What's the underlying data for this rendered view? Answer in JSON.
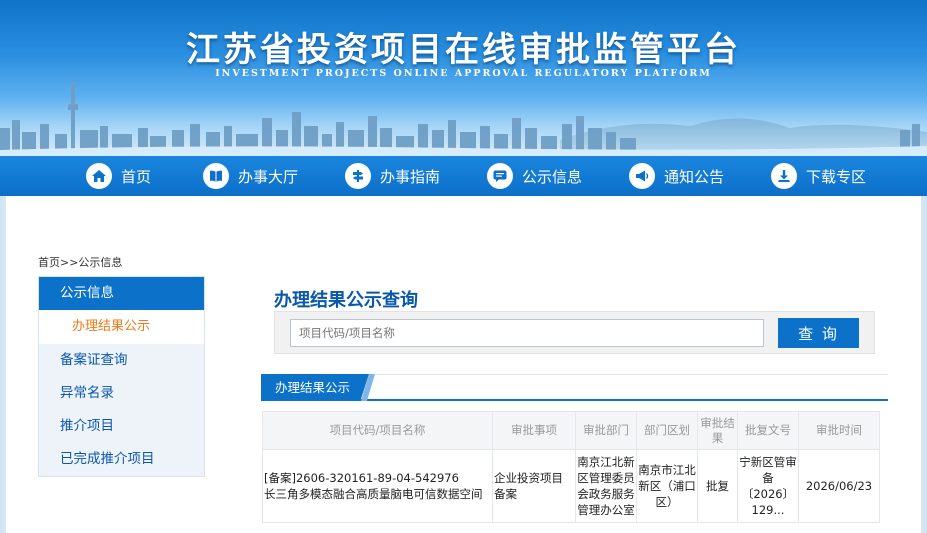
{
  "header": {
    "title": "江苏省投资项目在线审批监管平台",
    "subtitle": "INVESTMENT PROJECTS ONLINE APPROVAL REGULATORY PLATFORM"
  },
  "nav": [
    {
      "label": "首页",
      "icon": "home-icon"
    },
    {
      "label": "办事大厅",
      "icon": "book-icon"
    },
    {
      "label": "办事指南",
      "icon": "guide-icon"
    },
    {
      "label": "公示信息",
      "icon": "chat-icon"
    },
    {
      "label": "通知公告",
      "icon": "megaphone-icon"
    },
    {
      "label": "下载专区",
      "icon": "download-icon"
    }
  ],
  "breadcrumb": "首页>>公示信息",
  "sidebar": {
    "head": "公示信息",
    "active_sub": "办理结果公示",
    "items": [
      "备案证查询",
      "异常名录",
      "推介项目",
      "已完成推介项目"
    ]
  },
  "main": {
    "title": "办理结果公示查询",
    "search_placeholder": "项目代码/项目名称",
    "search_button": "查 询",
    "tab": "办理结果公示"
  },
  "table": {
    "headers": [
      "项目代码/项目名称",
      "审批事项",
      "审批部门",
      "部门区划",
      "审批结果",
      "批复文号",
      "审批时间"
    ],
    "rows": [
      {
        "code": "[备案]2606-320161-89-04-542976",
        "name": "长三角多模态融合高质量脑电可信数据空间",
        "item": "企业投资项目备案",
        "dept": "南京江北新区管理委员会政务服务管理办公室",
        "region": "南京市江北新区（浦口区）",
        "result": "批复",
        "doc_no": "宁新区管审备〔2026〕129...",
        "date": "2026/06/23"
      }
    ]
  },
  "colors": {
    "brand": "#0c72c9",
    "accent": "#f07a18",
    "link": "#0b57b0"
  }
}
